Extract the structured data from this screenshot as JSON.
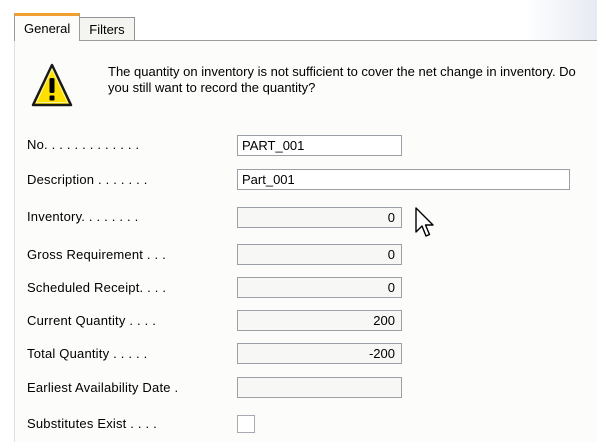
{
  "tabs": [
    {
      "label": "General",
      "active": true
    },
    {
      "label": "Filters",
      "active": false
    }
  ],
  "warning": {
    "icon": "warning-icon",
    "message": "The quantity on inventory is not sufficient to cover the net change in inventory. Do you still want to record the quantity?"
  },
  "fields": {
    "no": {
      "label": "No. . . . . . . . . . . . .",
      "value": "PART_001"
    },
    "description": {
      "label": "Description . . . . . . .",
      "value": "Part_001"
    },
    "inventory": {
      "label": "Inventory. . . . . . . .",
      "value": "0"
    },
    "gross_requirement": {
      "label": "Gross Requirement . . .",
      "value": "0"
    },
    "scheduled_receipt": {
      "label": "Scheduled Receipt. . . .",
      "value": "0"
    },
    "current_quantity": {
      "label": "Current Quantity . . . .",
      "value": "200"
    },
    "total_quantity": {
      "label": "Total Quantity . . . . .",
      "value": "-200"
    },
    "earliest_availability_date": {
      "label": "Earliest Availability Date .",
      "value": ""
    },
    "substitutes_exist": {
      "label": "Substitutes Exist . . . .",
      "checked": false
    }
  },
  "colors": {
    "active_tab_accent": "#f0a030",
    "warning_yellow": "#ffe000"
  }
}
